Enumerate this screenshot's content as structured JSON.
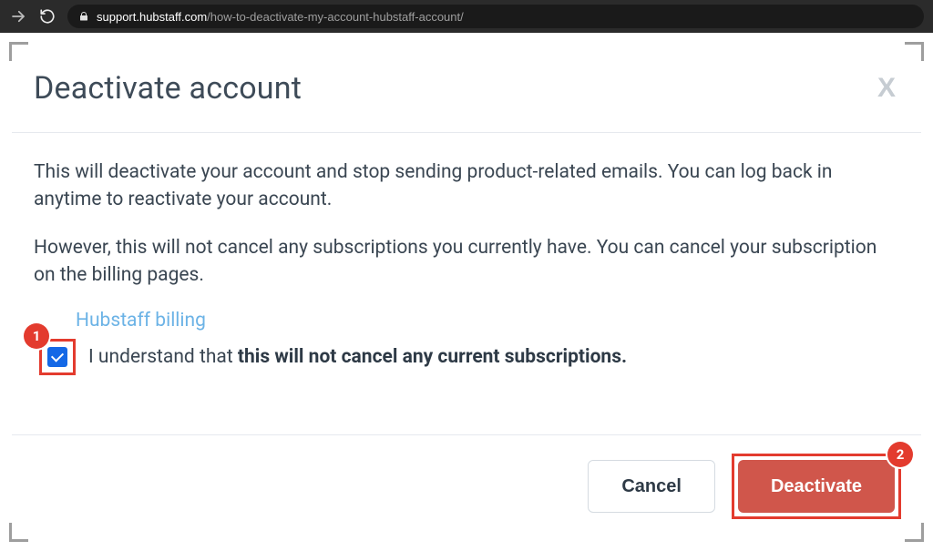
{
  "browser": {
    "url_host": "support.hubstaff.com",
    "url_path": "/how-to-deactivate-my-account-hubstaff-account/"
  },
  "modal": {
    "title": "Deactivate account",
    "close_label": "X",
    "body": {
      "paragraph1": "This will deactivate your account and stop sending product-related emails. You can log back in anytime to reactivate your account.",
      "paragraph2": "However, this will not cancel any subscriptions you currently have. You can cancel your subscription on the billing pages.",
      "billing_link": "Hubstaff billing",
      "confirm_prefix": "I understand that ",
      "confirm_strong": "this will not cancel any current subscriptions."
    },
    "footer": {
      "cancel_label": "Cancel",
      "deactivate_label": "Deactivate"
    },
    "annotations": {
      "marker1": "1",
      "marker2": "2"
    },
    "checkbox_checked": true
  },
  "colors": {
    "accent_red": "#e33b2e",
    "btn_red": "#d0564b",
    "link_blue": "#6cb3e6",
    "checkbox_blue": "#1468e6",
    "text": "#3a4652"
  }
}
